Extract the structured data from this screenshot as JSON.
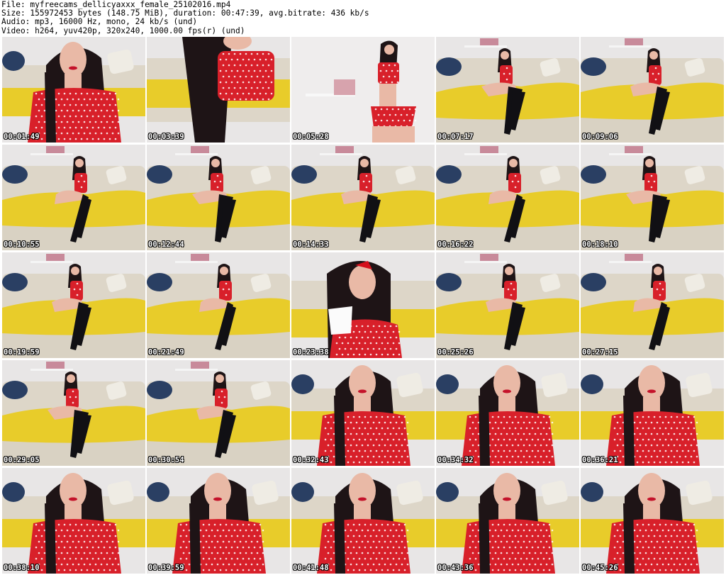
{
  "header": {
    "lines": [
      "File: myfreecams_dellicyaxxx_female_25102016.mp4",
      "Size: 155972453 bytes (148.75 MiB), duration: 00:47:39, avg.bitrate: 436 kb/s",
      "Audio: mp3, 16000 Hz, mono, 24 kb/s (und)",
      "Video: h264, yuv420p, 320x240, 1000.00 fps(r) (und)"
    ]
  },
  "colors": {
    "wall": "#e8e6e6",
    "sofa": "#ddd6c8",
    "blanket": "#e8cc2a",
    "dress": "#d8202a",
    "hair": "#1e1416",
    "skin": "#e9b9a6",
    "stocking": "#111014",
    "pillow_blue": "#2a3f63",
    "pillow_white": "#efece4"
  },
  "thumbnails": [
    {
      "time": "00:01:49",
      "scene": "closeup"
    },
    {
      "time": "00:03:39",
      "scene": "lean"
    },
    {
      "time": "00:05:28",
      "scene": "standing"
    },
    {
      "time": "00:07:17",
      "scene": "sitting"
    },
    {
      "time": "00:09:06",
      "scene": "sitting"
    },
    {
      "time": "00:10:55",
      "scene": "sitting"
    },
    {
      "time": "00:12:44",
      "scene": "sitting"
    },
    {
      "time": "00:14:33",
      "scene": "sitting"
    },
    {
      "time": "00:16:22",
      "scene": "sitting"
    },
    {
      "time": "00:18:10",
      "scene": "sitting"
    },
    {
      "time": "00:19:59",
      "scene": "sitting"
    },
    {
      "time": "00:21:49",
      "scene": "sitting"
    },
    {
      "time": "00:23:38",
      "scene": "cup"
    },
    {
      "time": "00:25:26",
      "scene": "sitting"
    },
    {
      "time": "00:27:15",
      "scene": "sitting"
    },
    {
      "time": "00:29:05",
      "scene": "sitting"
    },
    {
      "time": "00:30:54",
      "scene": "sitting"
    },
    {
      "time": "00:32:43",
      "scene": "closeup"
    },
    {
      "time": "00:34:32",
      "scene": "closeup"
    },
    {
      "time": "00:36:21",
      "scene": "closeup"
    },
    {
      "time": "00:38:10",
      "scene": "closeup"
    },
    {
      "time": "00:39:59",
      "scene": "closeup"
    },
    {
      "time": "00:41:48",
      "scene": "closeup"
    },
    {
      "time": "00:43:36",
      "scene": "closeup"
    },
    {
      "time": "00:45:26",
      "scene": "closeup"
    }
  ]
}
